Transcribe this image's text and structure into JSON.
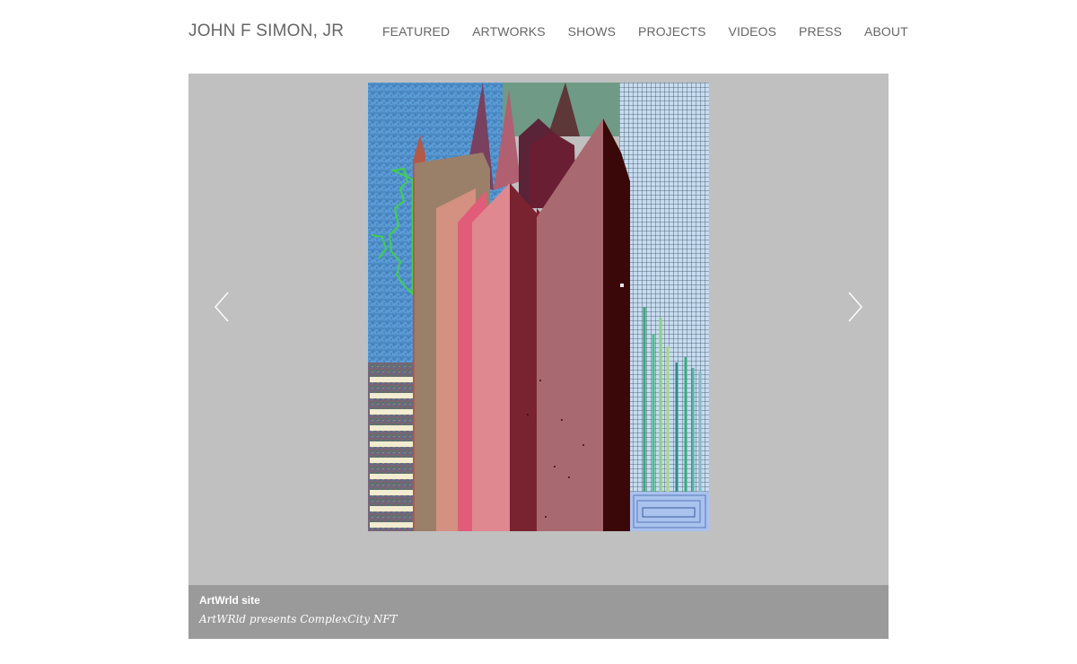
{
  "site": {
    "title": "JOHN F SIMON, JR"
  },
  "nav": {
    "items": [
      {
        "label": "FEATURED"
      },
      {
        "label": "ARTWORKS"
      },
      {
        "label": "SHOWS"
      },
      {
        "label": "PROJECTS"
      },
      {
        "label": "VIDEOS"
      },
      {
        "label": "PRESS"
      },
      {
        "label": "ABOUT"
      }
    ]
  },
  "slideshow": {
    "background": "#c0c0c0",
    "prev_icon": "chevron-left-icon",
    "next_icon": "chevron-right-icon",
    "caption": {
      "title": "ArtWrld site",
      "text": "ArtWRld presents ComplexCity NFT"
    }
  }
}
